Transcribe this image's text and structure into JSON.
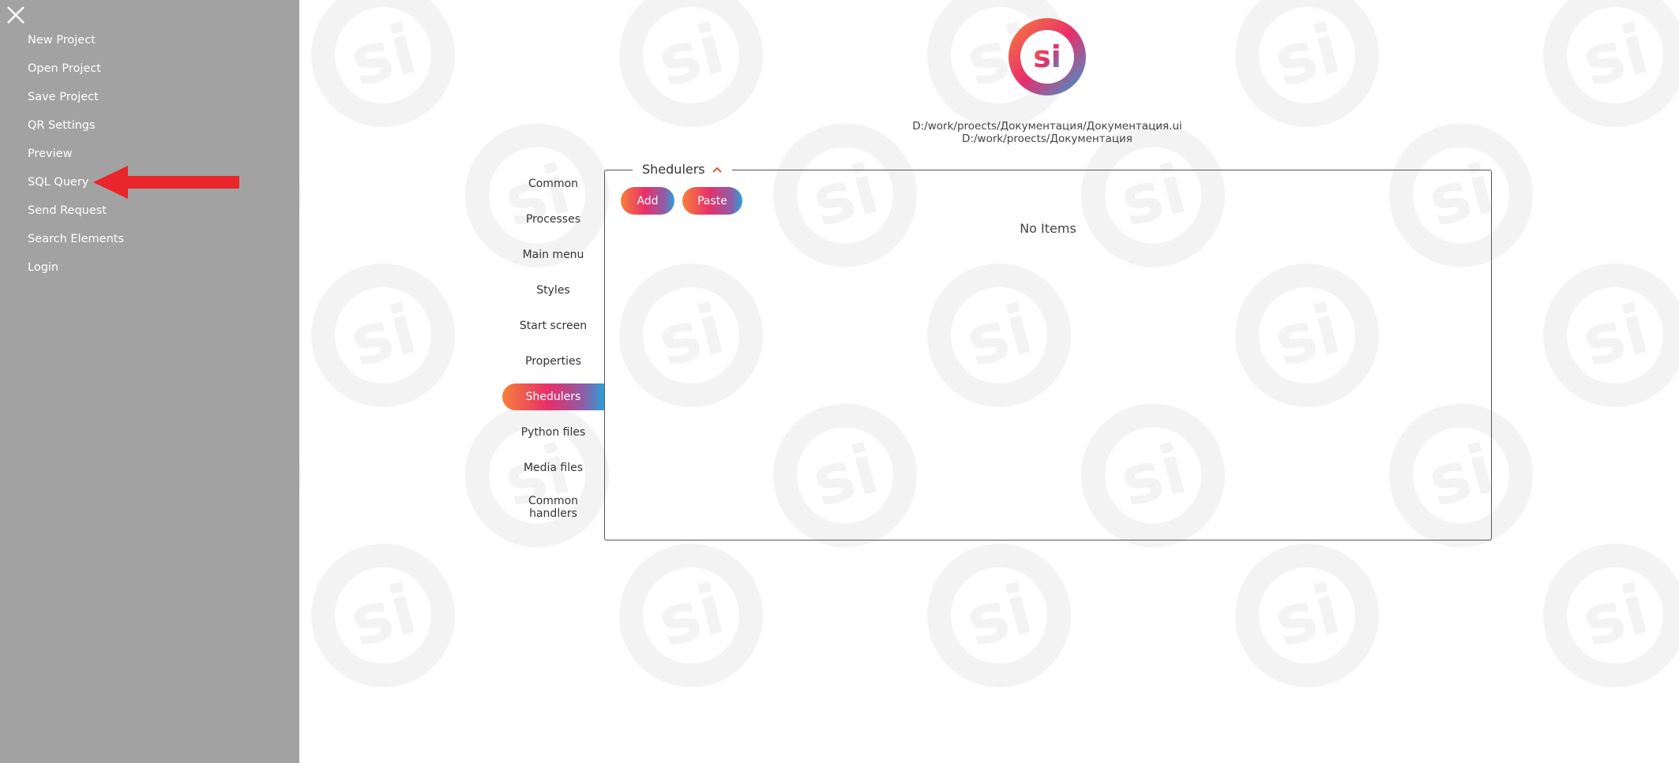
{
  "drawer": {
    "menu": [
      "New Project",
      "Open Project",
      "Save Project",
      "QR Settings",
      "Preview",
      "SQL Query",
      "Send Request",
      "Search Elements",
      "Login"
    ]
  },
  "header": {
    "logo_text": "si",
    "path_file": "D:/work/proects/Документация/Документация.ui",
    "path_dir": "D:/work/proects/Документация"
  },
  "tabs": [
    "Common",
    "Processes",
    "Main menu",
    "Styles",
    "Start screen",
    "Properties",
    "Shedulers",
    "Python files",
    "Media files",
    "Common handlers"
  ],
  "active_tab": "Shedulers",
  "panel": {
    "legend": "Shedulers",
    "add_label": "Add",
    "paste_label": "Paste",
    "empty_text": "No Items"
  },
  "colors": {
    "accent_orange": "#f6803a",
    "accent_pink": "#e82e6a",
    "accent_blue": "#2aa1d8",
    "drawer_bg": "#9b9b9b",
    "arrow_red": "#e8262b"
  },
  "icons": {
    "close": "close-icon",
    "chevron": "chevron-up-icon",
    "logo": "si-logo-icon"
  }
}
